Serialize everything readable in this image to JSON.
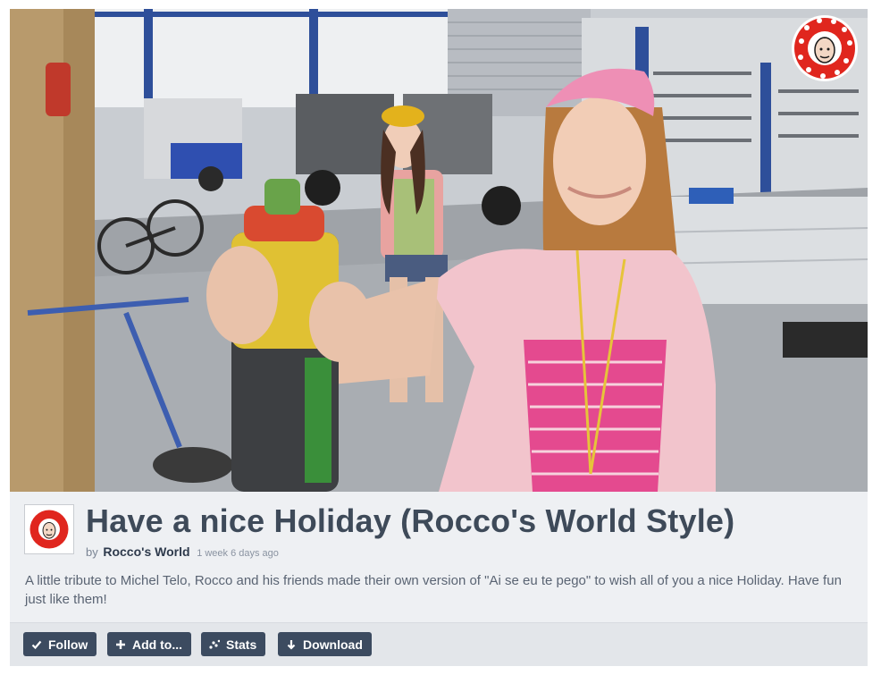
{
  "video": {
    "channel_logo_icon": "roccos-world-logo-icon"
  },
  "info": {
    "avatar_icon": "roccos-world-avatar-icon",
    "title": "Have a nice Holiday (Rocco's World Style)",
    "by_label": "by",
    "author": "Rocco's World",
    "time_ago": "1 week 6 days ago",
    "description": "A little tribute to Michel Telo, Rocco and his friends made their own version of \"Ai se eu te pego\" to wish all of you a nice Holiday. Have fun just like them!"
  },
  "actions": {
    "follow": "Follow",
    "add_to": "Add to...",
    "stats": "Stats",
    "download": "Download"
  },
  "colors": {
    "title": "#3e4a59",
    "button_bg": "#3c4b60",
    "panel_bg": "#eef0f3",
    "logo_red": "#e0261e"
  }
}
